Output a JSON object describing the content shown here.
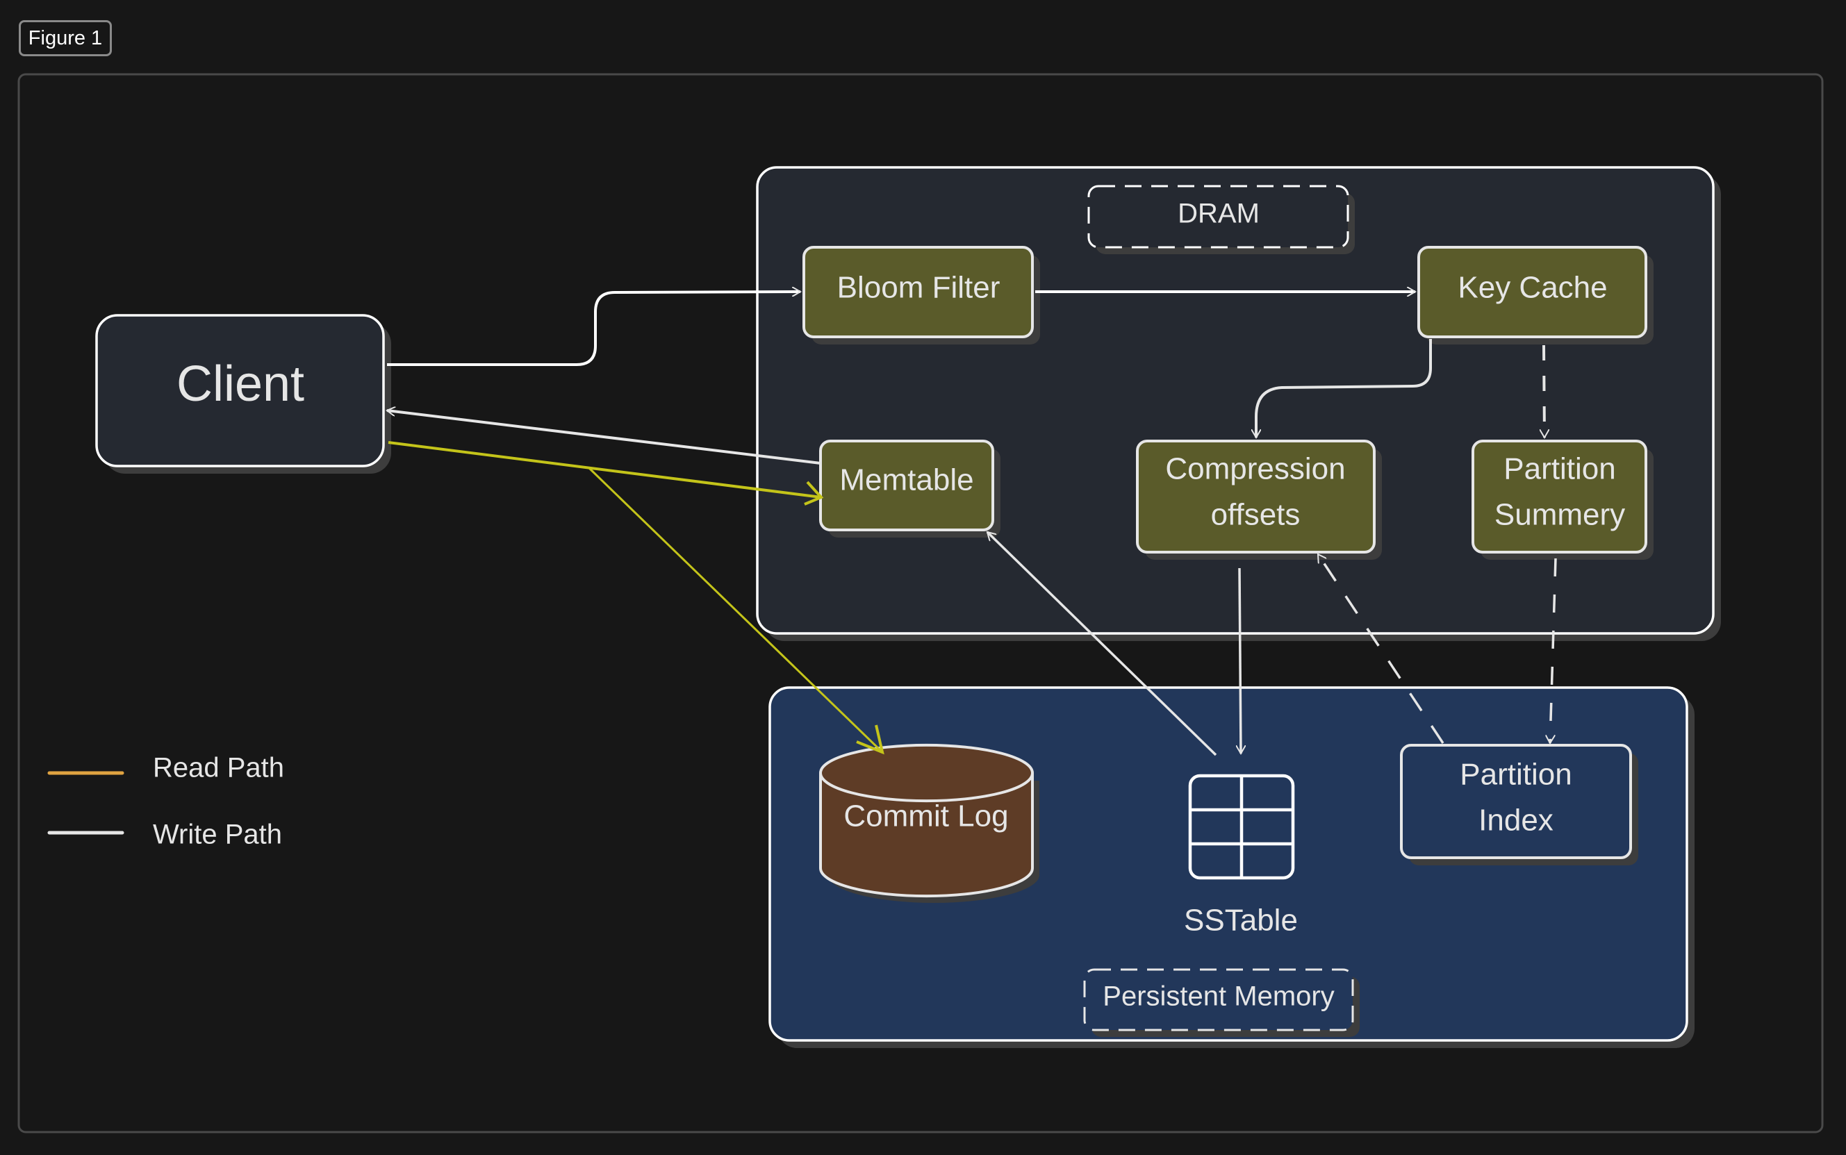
{
  "figure_tag": "Figure 1",
  "colors": {
    "background": "#171717",
    "frame": "#4a4a4a",
    "dram_fill": "#252931",
    "persistent_fill": "#22375a",
    "component_fill": "#5a5b2a",
    "commit_log_fill": "#5e3c26",
    "stroke": "#e6e6e6",
    "read_path": "#e0a341",
    "write_path": "#e6e6e6",
    "highlight_path": "#c4c41a",
    "shadow": "#3d3d3d"
  },
  "nodes": {
    "client": "Client",
    "dram_label": "DRAM",
    "bloom_filter": "Bloom Filter",
    "key_cache": "Key Cache",
    "memtable": "Memtable",
    "compression_offsets": [
      "Compression",
      "offsets"
    ],
    "partition_summary": [
      "Partition",
      "Summery"
    ],
    "commit_log": "Commit Log",
    "sstable": "SSTable",
    "partition_index": [
      "Partition",
      "Index"
    ],
    "persistent_label": "Persistent Memory"
  },
  "legend": [
    {
      "label": "Read Path",
      "color": "#e0a341"
    },
    {
      "label": "Write Path",
      "color": "#e6e6e6"
    }
  ],
  "edges": [
    {
      "from": "Client",
      "to": "Bloom Filter",
      "style": "solid"
    },
    {
      "from": "Bloom Filter",
      "to": "Key Cache",
      "style": "solid"
    },
    {
      "from": "Key Cache",
      "to": "Compression offsets",
      "style": "solid"
    },
    {
      "from": "Key Cache",
      "to": "Partition Summery",
      "style": "dashed"
    },
    {
      "from": "Memtable",
      "to": "Client",
      "style": "solid"
    },
    {
      "from": "Client",
      "to": "Memtable",
      "style": "highlight"
    },
    {
      "from": "Client",
      "to": "Commit Log",
      "style": "highlight"
    },
    {
      "from": "SSTable",
      "to": "Memtable",
      "style": "solid"
    },
    {
      "from": "Compression offsets",
      "to": "SSTable",
      "style": "solid"
    },
    {
      "from": "Partition Index",
      "to": "Compression offsets",
      "style": "dashed"
    },
    {
      "from": "Partition Summery",
      "to": "Partition Index",
      "style": "dashed"
    }
  ]
}
